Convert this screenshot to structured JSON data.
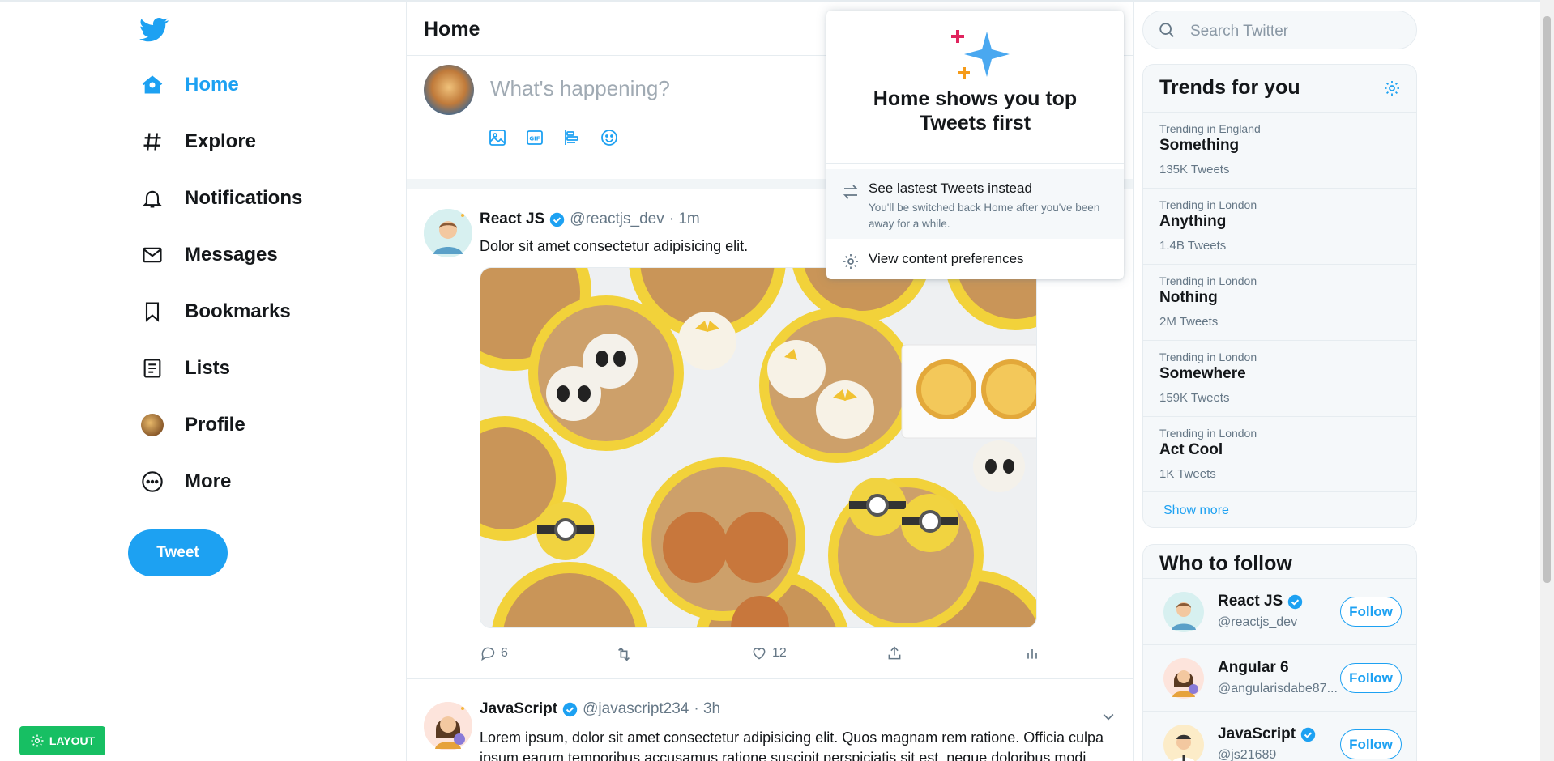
{
  "nav": {
    "items": [
      {
        "label": "Home",
        "icon": "home-icon"
      },
      {
        "label": "Explore",
        "icon": "hashtag-icon"
      },
      {
        "label": "Notifications",
        "icon": "bell-icon"
      },
      {
        "label": "Messages",
        "icon": "envelope-icon"
      },
      {
        "label": "Bookmarks",
        "icon": "bookmark-icon"
      },
      {
        "label": "Lists",
        "icon": "list-icon"
      },
      {
        "label": "Profile",
        "icon": "avatar"
      },
      {
        "label": "More",
        "icon": "more-circle-icon"
      }
    ],
    "tweet_button": "Tweet",
    "layout_button": "LAYOUT"
  },
  "main": {
    "title": "Home",
    "composer_placeholder": "What's happening?"
  },
  "tweets": [
    {
      "name": "React JS",
      "handle": "@reactjs_dev",
      "time": "· 1m",
      "text": "Dolor sit amet consectetur adipisicing elit.",
      "replies": "6",
      "likes": "12"
    },
    {
      "name": "JavaScript",
      "handle": "@javascript234",
      "time": "· 3h",
      "text": "Lorem ipsum, dolor sit amet consectetur adipisicing elit. Quos magnam rem ratione. Officia culpa ipsum earum temporibus accusamus ratione suscipit perspiciatis sit est, neque doloribus modi"
    }
  ],
  "popup": {
    "title": "Home shows you top Tweets first",
    "option1_title": "See lastest Tweets instead",
    "option1_desc": "You'll be switched back Home after you've been away for a while.",
    "option2_title": "View content preferences"
  },
  "search": {
    "placeholder": "Search Twitter"
  },
  "trends": {
    "title": "Trends for you",
    "items": [
      {
        "context": "Trending in England",
        "name": "Something",
        "count": "135K Tweets"
      },
      {
        "context": "Trending in London",
        "name": "Anything",
        "count": "1.4B Tweets"
      },
      {
        "context": "Trending in London",
        "name": "Nothing",
        "count": "2M Tweets"
      },
      {
        "context": "Trending in London",
        "name": "Somewhere",
        "count": "159K Tweets"
      },
      {
        "context": "Trending in London",
        "name": "Act Cool",
        "count": "1K Tweets"
      }
    ],
    "show_more": "Show more"
  },
  "who_to_follow": {
    "title": "Who to follow",
    "users": [
      {
        "name": "React JS",
        "handle": "@reactjs_dev",
        "verified": true
      },
      {
        "name": "Angular 6",
        "handle": "@angularisdabe87...",
        "verified": false
      },
      {
        "name": "JavaScript",
        "handle": "@js21689",
        "verified": true
      }
    ],
    "follow_label": "Follow"
  },
  "colors": {
    "accent": "#1da1f2",
    "text": "#14171a",
    "muted": "#657786",
    "layout_green": "#17bf63"
  }
}
